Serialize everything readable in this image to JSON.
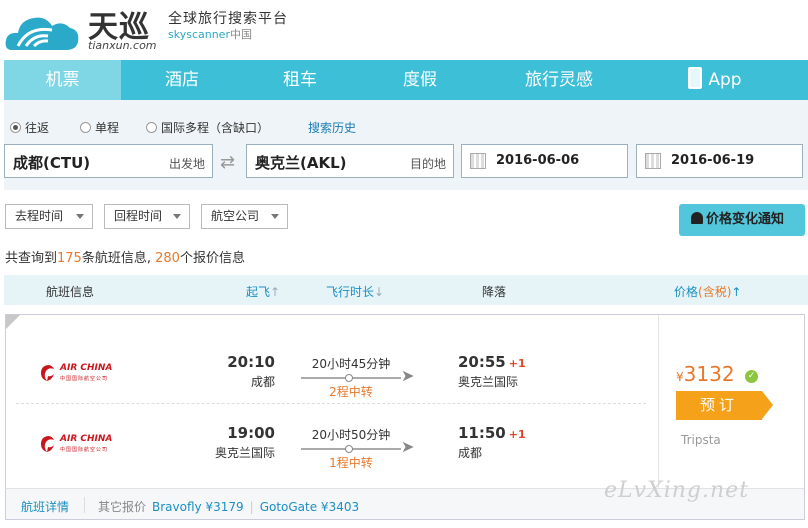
{
  "brand": {
    "name_cn": "天巡",
    "domain": "tianxun.com",
    "slogan": "全球旅行搜索平台",
    "sub_sky": "skyscanner",
    "sub_cn": "中国"
  },
  "nav": {
    "items": [
      {
        "label": "机票",
        "active": true
      },
      {
        "label": "酒店"
      },
      {
        "label": "租车"
      },
      {
        "label": "度假"
      },
      {
        "label": "旅行灵感"
      },
      {
        "label": "App"
      }
    ]
  },
  "search": {
    "trip_types": [
      {
        "label": "往返",
        "checked": true
      },
      {
        "label": "单程",
        "checked": false
      },
      {
        "label": "国际多程（含缺口）",
        "checked": false
      }
    ],
    "history_label": "搜索历史",
    "origin": {
      "value": "成都(CTU)",
      "hint": "出发地"
    },
    "destination": {
      "value": "奥克兰(AKL)",
      "hint": "目的地"
    },
    "depart_date": "2016-06-06",
    "return_date": "2016-06-19",
    "swap_icon": "swap-arrows-icon"
  },
  "filters": {
    "items": [
      "去程时间",
      "回程时间",
      "航空公司"
    ],
    "alert_label": "价格变化通知"
  },
  "summary": {
    "prefix": "共查询到",
    "flight_count": "175",
    "mid": "条航班信息,",
    "price_count": "280",
    "suffix": "个报价信息"
  },
  "columns": {
    "flight_info": "航班信息",
    "departure": "起飞",
    "duration": "飞行时长",
    "landing": "降落",
    "price": "价格",
    "tax": "(含税)"
  },
  "result": {
    "legs": [
      {
        "airline": "AIR CHINA",
        "airline_sub": "中国国际航空公司",
        "dep_time": "20:10",
        "dep_city": "成都",
        "duration": "20小时45分钟",
        "stops": "2程中转",
        "arr_time": "20:55",
        "day_offset": "+1",
        "arr_city": "奥克兰国际"
      },
      {
        "airline": "AIR CHINA",
        "airline_sub": "中国国际航空公司",
        "dep_time": "19:00",
        "dep_city": "奥克兰国际",
        "duration": "20小时50分钟",
        "stops": "1程中转",
        "arr_time": "11:50",
        "day_offset": "+1",
        "arr_city": "成都"
      }
    ],
    "currency": "¥",
    "price": "3132",
    "book_label": "预订",
    "provider": "Tripsta",
    "detail_label": "航班详情",
    "other_label": "其它报价",
    "other_prices": [
      "Bravofly ¥3179",
      "GotoGate ¥3403"
    ]
  },
  "colors": {
    "nav_bg": "#3dbfd7",
    "nav_active": "#7fd7e6",
    "price": "#e8782a",
    "book_button": "#f5a11a",
    "airline_red": "#c9161d",
    "link": "#1a8fc4"
  },
  "watermark": "eLvXing.net"
}
